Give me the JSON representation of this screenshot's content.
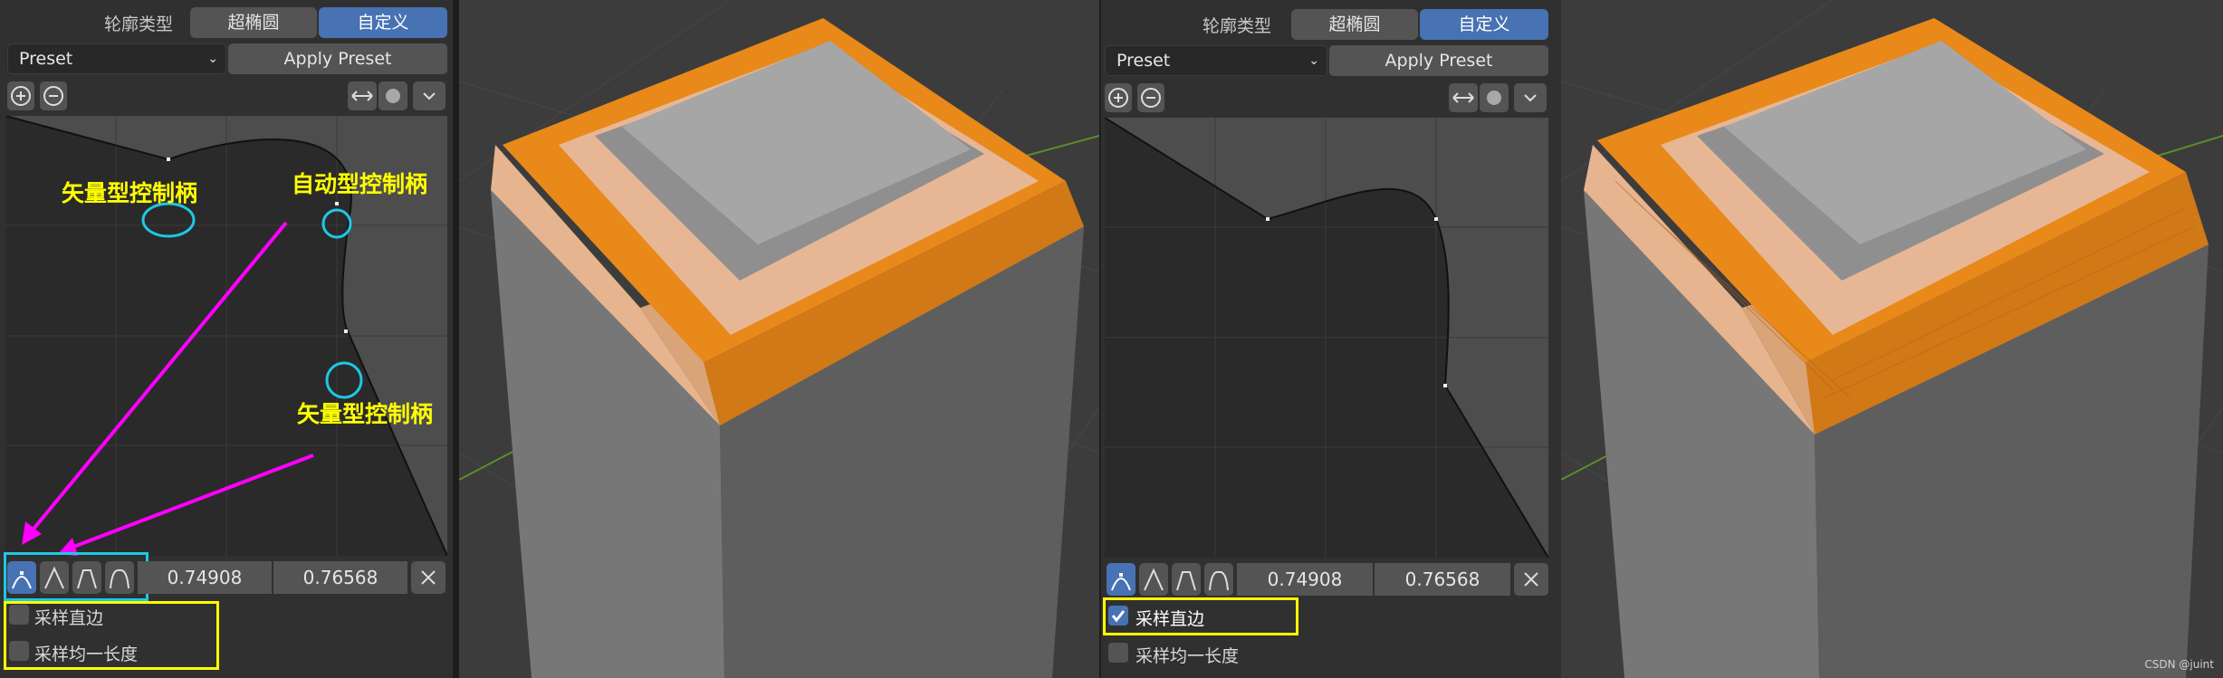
{
  "left_panel": {
    "profile_type_label": "轮廓类型",
    "profile_options": [
      "超椭圆",
      "自定义"
    ],
    "preset_dropdown": "Preset",
    "apply_preset": "Apply Preset",
    "value_x": "0.74908",
    "value_y": "0.76568",
    "sample_straight_edges": "采样直边",
    "sample_even_lengths": "采样均一长度",
    "sample_straight_edges_checked": false,
    "sample_even_lengths_checked": false,
    "annotations": [
      "矢量型控制柄",
      "自动型控制柄",
      "矢量型控制柄"
    ]
  },
  "right_panel": {
    "profile_type_label": "轮廓类型",
    "profile_options": [
      "超椭圆",
      "自定义"
    ],
    "preset_dropdown": "Preset",
    "apply_preset": "Apply Preset",
    "value_x": "0.74908",
    "value_y": "0.76568",
    "sample_straight_edges": "采样直边",
    "sample_even_lengths": "采样均一长度",
    "sample_straight_edges_checked": true,
    "sample_even_lengths_checked": false
  },
  "watermark": "CSDN @juint",
  "colors": {
    "accent": "#4772b3",
    "annotation_yellow": "#ffff00",
    "arrow_magenta": "#ff00ff",
    "circle_cyan": "#1ec8e6",
    "bevel_orange": "#e8891a"
  },
  "icons": [
    "zoom-in-icon",
    "zoom-out-icon",
    "reset-view-icon",
    "clip-icon",
    "chevron-down-icon",
    "handle-auto-icon",
    "handle-vector-icon",
    "handle-auto-clamped-icon",
    "handle-free-icon",
    "delete-x-icon",
    "checkmark-icon"
  ]
}
